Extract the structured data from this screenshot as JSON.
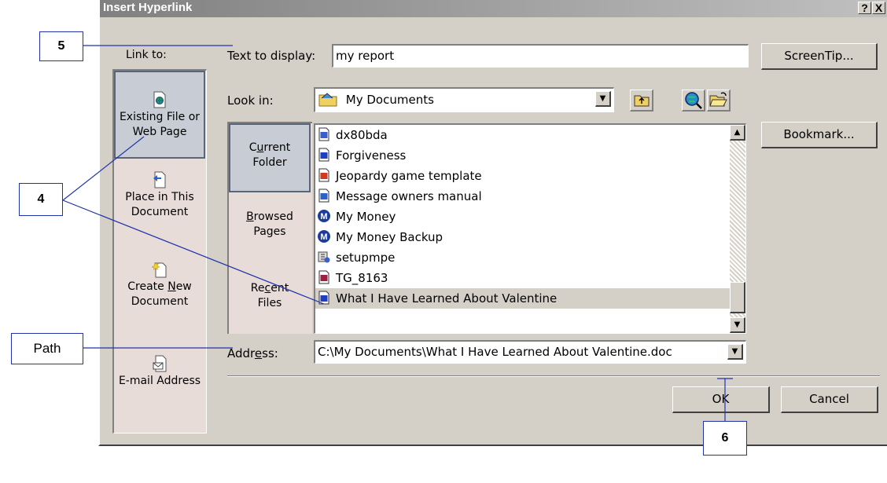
{
  "dialog": {
    "title": "Insert Hyperlink",
    "help_glyph": "?",
    "close_glyph": "X",
    "link_to_label": "Link to:",
    "text_to_display_label": "Text to display:",
    "text_to_display_value": "my report",
    "screentip_label": "ScreenTip...",
    "look_in_label": "Look in:",
    "look_in_value": "My Documents",
    "bookmark_label": "Bookmark...",
    "address_label": "Address:",
    "address_value": "C:\\My Documents\\What I Have Learned About Valentine.doc",
    "ok_label": "OK",
    "cancel_label": "Cancel"
  },
  "link_to_items": [
    {
      "line1": "Existing File or",
      "line2": "Web Page",
      "icon": "existing-file-icon",
      "selected": true
    },
    {
      "line1": "Place in This",
      "line2": "Document",
      "icon": "place-in-document-icon",
      "selected": false
    },
    {
      "line1": "Create New",
      "line2": "Document",
      "icon": "new-document-icon",
      "selected": false
    },
    {
      "line1": "E-mail Address",
      "line2": "",
      "icon": "email-icon",
      "selected": false
    }
  ],
  "nav_items": [
    {
      "line1": "Current",
      "line2": "Folder",
      "selected": true
    },
    {
      "line1": "Browsed",
      "line2": "Pages",
      "selected": false
    },
    {
      "line1": "Recent",
      "line2": "Files",
      "selected": false
    }
  ],
  "files": [
    {
      "name": "dx80bda",
      "icon": "program-icon",
      "color": "#3a5fcd"
    },
    {
      "name": "Forgiveness",
      "icon": "word-doc-icon",
      "color": "#1f3fbf"
    },
    {
      "name": "Jeopardy game template",
      "icon": "powerpoint-icon",
      "color": "#d03a20"
    },
    {
      "name": "Message owners manual",
      "icon": "help-file-icon",
      "color": "#2a62c8"
    },
    {
      "name": "My Money",
      "icon": "money-icon",
      "color": "#1b3c9c"
    },
    {
      "name": "My Money Backup",
      "icon": "money-icon",
      "color": "#1b3c9c"
    },
    {
      "name": "setupmpe",
      "icon": "setup-icon",
      "color": "#6a6a6a"
    },
    {
      "name": "TG_8163",
      "icon": "image-file-icon",
      "color": "#9c2040"
    },
    {
      "name": "What I Have Learned About Valentine",
      "icon": "word-doc-icon",
      "color": "#1f3fbf",
      "selected": true
    }
  ],
  "callouts": {
    "c5": "5",
    "c4": "4",
    "path": "Path",
    "c6": "6"
  },
  "colors": {
    "dialog_face": "#d4d0c8",
    "panel_bg": "#e8dcd8",
    "callout_line": "#2233aa"
  }
}
